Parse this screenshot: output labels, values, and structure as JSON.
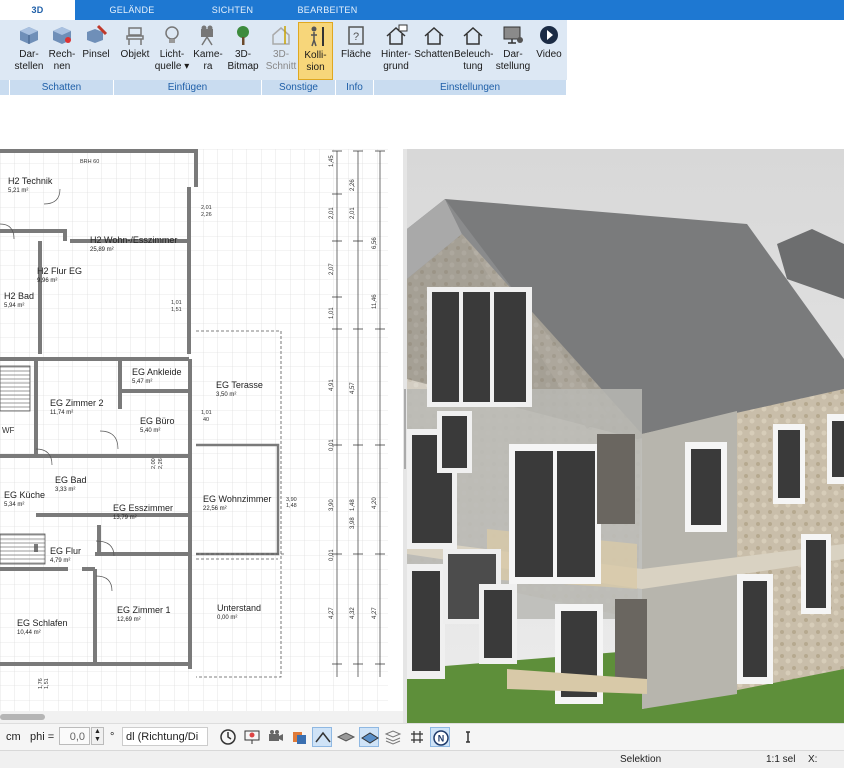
{
  "tabs": [
    {
      "label": "3D",
      "active": true
    },
    {
      "label": "GELÄNDE",
      "active": false
    },
    {
      "label": "SICHTEN",
      "active": false
    },
    {
      "label": "BEARBEITEN",
      "active": false
    }
  ],
  "ribbon": {
    "buttons": [
      {
        "l1": "Dar-",
        "l2": "stellen",
        "icon": "render-cube-icon"
      },
      {
        "l1": "Rech-",
        "l2": "nen",
        "icon": "calculate-cube-icon"
      },
      {
        "l1": "Pinsel",
        "l2": "",
        "icon": "brush-cube-icon"
      },
      {
        "l1": "Objekt",
        "l2": "",
        "icon": "chair-icon"
      },
      {
        "l1": "Licht-",
        "l2": "quelle ▾",
        "icon": "lightbulb-icon"
      },
      {
        "l1": "Kame-",
        "l2": "ra",
        "icon": "camera-icon"
      },
      {
        "l1": "3D-",
        "l2": "Bitmap",
        "icon": "tree-icon"
      },
      {
        "l1": "3D-",
        "l2": "Schnitt",
        "icon": "section-house-icon"
      },
      {
        "l1": "Kolli-",
        "l2": "sion",
        "icon": "person-collision-icon"
      },
      {
        "l1": "Fläche",
        "l2": "",
        "icon": "help-book-icon"
      },
      {
        "l1": "Hinter-",
        "l2": "grund",
        "icon": "house-background-icon"
      },
      {
        "l1": "Schatten",
        "l2": "",
        "icon": "house-shadow-icon"
      },
      {
        "l1": "Beleuch-",
        "l2": "tung",
        "icon": "house-light-icon"
      },
      {
        "l1": "Dar-",
        "l2": "stellung",
        "icon": "monitor-settings-icon"
      },
      {
        "l1": "Video",
        "l2": "",
        "icon": "play-icon"
      }
    ],
    "groups": [
      "Schatten",
      "Einfügen",
      "Sonstige",
      "Info",
      "Einstellungen"
    ]
  },
  "plan": {
    "rooms": [
      {
        "name": "H2 Technik",
        "area": "5,21 m²"
      },
      {
        "name": "H2 Wohn-/Esszimmer",
        "area": "25,89 m²"
      },
      {
        "name": "H2 Flur EG",
        "area": "9,96 m²"
      },
      {
        "name": "H2 Bad",
        "area": "5,94 m²"
      },
      {
        "name": "EG Ankleide",
        "area": "5,47 m²"
      },
      {
        "name": "EG Terasse",
        "area": "3,50 m²"
      },
      {
        "name": "EG Zimmer 2",
        "area": "11,74 m²"
      },
      {
        "name": "EG Büro",
        "area": "5,40 m²"
      },
      {
        "name": "EG Bad",
        "area": "3,33 m²"
      },
      {
        "name": "EG Küche",
        "area": "5,34 m²"
      },
      {
        "name": "EG Esszimmer",
        "area": "13,79 m²"
      },
      {
        "name": "EG Wohnzimmer",
        "area": "22,56 m²"
      },
      {
        "name": "EG Flur",
        "area": "4,79 m²"
      },
      {
        "name": "EG Schlafen",
        "area": "10,44 m²"
      },
      {
        "name": "EG Zimmer 1",
        "area": "12,69 m²"
      },
      {
        "name": "Unterstand",
        "area": "0,00 m²"
      }
    ],
    "dims_a": [
      "1,45",
      "2,01",
      "2,07",
      "1,01",
      "4,91",
      "0,01",
      "3,90",
      "4,27",
      "0,01"
    ],
    "dims_b": [
      "2,01",
      "2,26",
      "4,57",
      "1,48",
      "3,98",
      "4,32"
    ],
    "dims_c": [
      "6,56",
      "11,46",
      "4,20",
      "4,27"
    ],
    "small": [
      "2,01",
      "2,26",
      "1,01",
      "1,51",
      "1,01",
      "40",
      "2,00",
      "2,26",
      "3,90",
      "1,48",
      "1,76",
      "1,51",
      "WF",
      "BRH 60"
    ]
  },
  "toolbar": {
    "unit": "cm",
    "phi_label": "phi =",
    "phi_value": "0,0",
    "deg": "°",
    "dl_value": "dl (Richtung/Di"
  },
  "status": {
    "mode": "Selektion",
    "scale": "1:1 sel",
    "x_label": "X:"
  }
}
